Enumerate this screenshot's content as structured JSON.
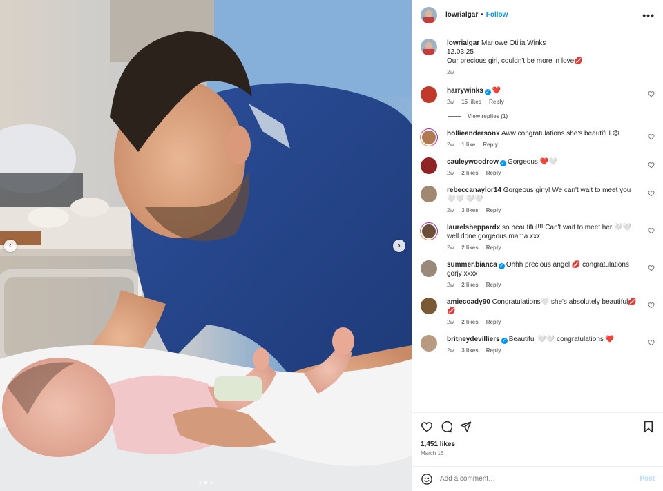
{
  "post": {
    "author": "lowrialgar",
    "separator": "•",
    "follow_label": "Follow",
    "more_label": "•••",
    "caption": {
      "user": "lowrialgar",
      "line1": "Marlowe Otilia Winks",
      "line2": "12.03.25",
      "line3": "Our precious girl, couldn't be more in love💋",
      "age": "2w"
    },
    "likes_count": "1,451 likes",
    "date": "March 16",
    "add_comment_placeholder": "Add a comment…",
    "post_label": "Post",
    "carousel": {
      "prev": "‹",
      "next": "›",
      "slides": 3,
      "active": 1
    }
  },
  "comments": [
    {
      "user": "harrywinks",
      "verified": true,
      "text": "❤️",
      "age": "2w",
      "likes": "15 likes",
      "reply": "Reply",
      "view_replies": "View replies (1)",
      "avatar_color": "#c0392b",
      "ring": false
    },
    {
      "user": "hollieandersonx",
      "verified": false,
      "text": "Aww congratulations she's beautiful 😍",
      "age": "2w",
      "likes": "1 like",
      "reply": "Reply",
      "avatar_color": "#b07a52",
      "ring": true
    },
    {
      "user": "cauleywoodrow",
      "verified": true,
      "text": "Gorgeous ❤️🤍",
      "age": "2w",
      "likes": "2 likes",
      "reply": "Reply",
      "avatar_color": "#8e2424",
      "ring": false
    },
    {
      "user": "rebeccanaylor14",
      "verified": false,
      "text": "Gorgeous girly! We can't wait to meet you 🤍🤍 🤍🤍",
      "age": "2w",
      "likes": "3 likes",
      "reply": "Reply",
      "avatar_color": "#a18870",
      "ring": false
    },
    {
      "user": "laurelsheppardx",
      "verified": false,
      "text": "so beautiful!!! Can't wait to meet her 🤍🤍 well done gorgeous mama xxx",
      "age": "2w",
      "likes": "2 likes",
      "reply": "Reply",
      "avatar_color": "#6b4f3a",
      "ring": true
    },
    {
      "user": "summer.bianca",
      "verified": true,
      "text": "Ohhh precious angel 💋 congratulations gorjy xxxx",
      "age": "2w",
      "likes": "2 likes",
      "reply": "Reply",
      "avatar_color": "#9a8878",
      "ring": false
    },
    {
      "user": "amiecoady90",
      "verified": false,
      "text": "Congratulations🤍 she's absolutely beautiful💋💋",
      "age": "2w",
      "likes": "2 likes",
      "reply": "Reply",
      "avatar_color": "#7a5a34",
      "ring": false
    },
    {
      "user": "britneydevilliers",
      "verified": true,
      "text": "Beautiful 🤍🤍 congratulations ❤️",
      "age": "2w",
      "likes": "3 likes",
      "reply": "Reply",
      "avatar_color": "#b89a80",
      "ring": false
    }
  ],
  "colors": {
    "accent": "#0095f6",
    "muted": "#737373",
    "text": "#262626",
    "heart": "#ed4956"
  }
}
